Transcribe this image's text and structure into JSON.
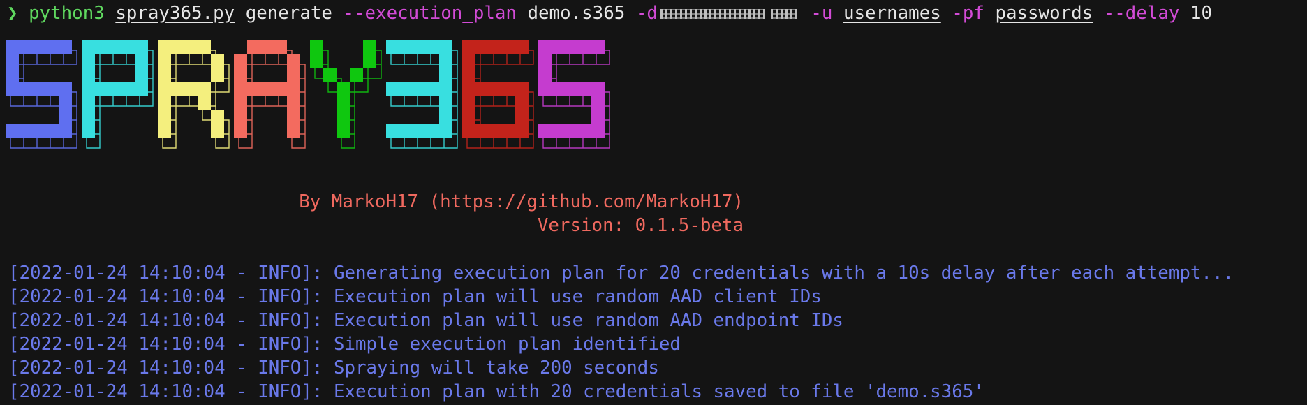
{
  "terminal": {
    "command": {
      "prompt_symbol": "❯",
      "program": "python3",
      "script": "spray365.py",
      "subcommand": "generate",
      "flag_plan": "--execution_plan",
      "plan_file": "demo.s365",
      "flag_domain": "-d",
      "flag_users": "-u",
      "users_file": "usernames",
      "flag_passwords": "-pf",
      "passwords_file": "passwords",
      "flag_delay": "--delay",
      "delay_value": "10"
    },
    "banner": {
      "letters": [
        "S",
        "P",
        "R",
        "A",
        "Y",
        "3",
        "6",
        "5"
      ],
      "colors": [
        "#5f6ff0",
        "#38dfe0",
        "#f4ef7e",
        "#f36b5f",
        "#0fc70f",
        "#38dfe0",
        "#c3231b",
        "#c53ccf"
      ],
      "author": "By MarkoH17 (https://github.com/MarkoH17)",
      "version": "Version: 0.1.5-beta"
    },
    "log": [
      {
        "prefix": "[2022-01-24 14:10:04 - INFO]:",
        "message": "Generating execution plan for 20 credentials with a 10s delay after each attempt..."
      },
      {
        "prefix": "[2022-01-24 14:10:04 - INFO]:",
        "message": "Execution plan will use random AAD client IDs"
      },
      {
        "prefix": "[2022-01-24 14:10:04 - INFO]:",
        "message": "Execution plan will use random AAD endpoint IDs"
      },
      {
        "prefix": "[2022-01-24 14:10:04 - INFO]:",
        "message": "Simple execution plan identified"
      },
      {
        "prefix": "[2022-01-24 14:10:04 - INFO]:",
        "message": "Spraying will take 200 seconds"
      },
      {
        "prefix": "[2022-01-24 14:10:04 - INFO]:",
        "message": "Execution plan with 20 credentials saved to file 'demo.s365'"
      }
    ],
    "colors": {
      "background": "#141414",
      "prompt": "#5fd75f",
      "flags": "#d24bd6",
      "credit": "#f0695f",
      "log": "#6a79ea"
    }
  }
}
